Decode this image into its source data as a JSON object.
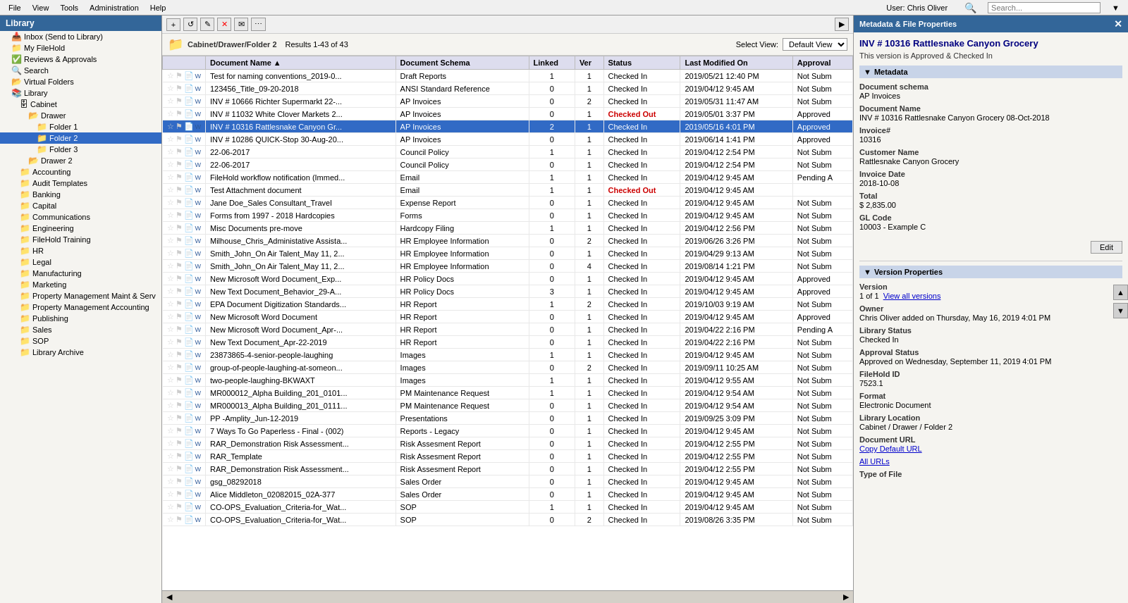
{
  "menubar": {
    "items": [
      "File",
      "View",
      "Tools",
      "Administration",
      "Help"
    ],
    "user": "User: Chris Oliver"
  },
  "sidebar": {
    "header": "Library",
    "items": [
      {
        "id": "inbox",
        "label": "Inbox (Send to Library)",
        "indent": 1,
        "icon": "📥"
      },
      {
        "id": "myfilehold",
        "label": "My FileHold",
        "indent": 1,
        "icon": "📁"
      },
      {
        "id": "reviews",
        "label": "Reviews & Approvals",
        "indent": 1,
        "icon": "✅"
      },
      {
        "id": "search",
        "label": "Search",
        "indent": 1,
        "icon": "🔍"
      },
      {
        "id": "virtualfolders",
        "label": "Virtual Folders",
        "indent": 1,
        "icon": "📂"
      },
      {
        "id": "library",
        "label": "Library",
        "indent": 1,
        "icon": "📚",
        "expanded": true
      },
      {
        "id": "cabinet",
        "label": "Cabinet",
        "indent": 2,
        "icon": "🗄",
        "expanded": true
      },
      {
        "id": "drawer",
        "label": "Drawer",
        "indent": 3,
        "icon": "📂",
        "expanded": true
      },
      {
        "id": "folder1",
        "label": "Folder 1",
        "indent": 4,
        "icon": "📁"
      },
      {
        "id": "folder2",
        "label": "Folder 2",
        "indent": 4,
        "icon": "📁",
        "selected": true
      },
      {
        "id": "folder3",
        "label": "Folder 3",
        "indent": 4,
        "icon": "📁"
      },
      {
        "id": "drawer2",
        "label": "Drawer 2",
        "indent": 3,
        "icon": "📂"
      },
      {
        "id": "accounting",
        "label": "Accounting",
        "indent": 2,
        "icon": "📁"
      },
      {
        "id": "audittemplates",
        "label": "Audit Templates",
        "indent": 2,
        "icon": "📁"
      },
      {
        "id": "banking",
        "label": "Banking",
        "indent": 2,
        "icon": "📁"
      },
      {
        "id": "capital",
        "label": "Capital",
        "indent": 2,
        "icon": "📁"
      },
      {
        "id": "communications",
        "label": "Communications",
        "indent": 2,
        "icon": "📁"
      },
      {
        "id": "engineering",
        "label": "Engineering",
        "indent": 2,
        "icon": "📁"
      },
      {
        "id": "fileholdtraining",
        "label": "FileHold Training",
        "indent": 2,
        "icon": "📁"
      },
      {
        "id": "hr",
        "label": "HR",
        "indent": 2,
        "icon": "📁"
      },
      {
        "id": "legal",
        "label": "Legal",
        "indent": 2,
        "icon": "📁"
      },
      {
        "id": "manufacturing",
        "label": "Manufacturing",
        "indent": 2,
        "icon": "📁"
      },
      {
        "id": "marketing",
        "label": "Marketing",
        "indent": 2,
        "icon": "📁"
      },
      {
        "id": "propmaint",
        "label": "Property Management  Maint & Serv",
        "indent": 2,
        "icon": "📁"
      },
      {
        "id": "propaccounting",
        "label": "Property Management Accounting",
        "indent": 2,
        "icon": "📁"
      },
      {
        "id": "publishing",
        "label": "Publishing",
        "indent": 2,
        "icon": "📁"
      },
      {
        "id": "sales",
        "label": "Sales",
        "indent": 2,
        "icon": "📁"
      },
      {
        "id": "sop",
        "label": "SOP",
        "indent": 2,
        "icon": "📁"
      },
      {
        "id": "libraryarchive",
        "label": "Library Archive",
        "indent": 2,
        "icon": "📁"
      }
    ]
  },
  "content": {
    "folder_path": "Cabinet/Drawer/Folder 2",
    "results_label": "Results 1-43 of 43",
    "view_label": "Select View:",
    "view_options": [
      "Default View"
    ],
    "view_selected": "Default View",
    "columns": [
      "Document Name",
      "Document Schema",
      "Linked",
      "Ver",
      "Status",
      "Last Modified On",
      "Approval"
    ],
    "rows": [
      {
        "name": "Test for naming conventions_2019-0...",
        "schema": "Draft Reports",
        "linked": "1",
        "ver": "1",
        "status": "Checked In",
        "modified": "2019/05/21 12:40 PM",
        "approval": "Not Subm"
      },
      {
        "name": "123456_Title_09-20-2018",
        "schema": "ANSI Standard Reference",
        "linked": "0",
        "ver": "1",
        "status": "Checked In",
        "modified": "2019/04/12 9:45 AM",
        "approval": "Not Subm"
      },
      {
        "name": "INV # 10666 Richter Supermarkt 22-...",
        "schema": "AP Invoices",
        "linked": "0",
        "ver": "2",
        "status": "Checked In",
        "modified": "2019/05/31 11:47 AM",
        "approval": "Not Subm"
      },
      {
        "name": "INV # 11032 White Clover Markets 2...",
        "schema": "AP Invoices",
        "linked": "0",
        "ver": "1",
        "status": "Checked Out",
        "modified": "2019/05/01 3:37 PM",
        "approval": "Approved",
        "checked_out": true
      },
      {
        "name": "INV # 10316 Rattlesnake Canyon Gr...",
        "schema": "AP Invoices",
        "linked": "2",
        "ver": "1",
        "status": "Checked In",
        "modified": "2019/05/16 4:01 PM",
        "approval": "Approved",
        "selected": true
      },
      {
        "name": "INV # 10286 QUICK-Stop 30-Aug-20...",
        "schema": "AP Invoices",
        "linked": "0",
        "ver": "1",
        "status": "Checked In",
        "modified": "2019/06/14 1:41 PM",
        "approval": "Approved"
      },
      {
        "name": "22-06-2017",
        "schema": "Council Policy",
        "linked": "1",
        "ver": "1",
        "status": "Checked In",
        "modified": "2019/04/12 2:54 PM",
        "approval": "Not Subm"
      },
      {
        "name": "22-06-2017",
        "schema": "Council Policy",
        "linked": "0",
        "ver": "1",
        "status": "Checked In",
        "modified": "2019/04/12 2:54 PM",
        "approval": "Not Subm"
      },
      {
        "name": "FileHold workflow notification (Immed...",
        "schema": "Email",
        "linked": "1",
        "ver": "1",
        "status": "Checked In",
        "modified": "2019/04/12 9:45 AM",
        "approval": "Pending A"
      },
      {
        "name": "Test Attachment document",
        "schema": "Email",
        "linked": "1",
        "ver": "1",
        "status": "Checked Out",
        "modified": "2019/04/12 9:45 AM",
        "approval": "",
        "checked_out": true
      },
      {
        "name": "Jane Doe_Sales Consultant_Travel",
        "schema": "Expense Report",
        "linked": "0",
        "ver": "1",
        "status": "Checked In",
        "modified": "2019/04/12 9:45 AM",
        "approval": "Not Subm"
      },
      {
        "name": "Forms from 1997 - 2018 Hardcopies",
        "schema": "Forms",
        "linked": "0",
        "ver": "1",
        "status": "Checked In",
        "modified": "2019/04/12 9:45 AM",
        "approval": "Not Subm"
      },
      {
        "name": "Misc Documents pre-move",
        "schema": "Hardcopy Filing",
        "linked": "1",
        "ver": "1",
        "status": "Checked In",
        "modified": "2019/04/12 2:56 PM",
        "approval": "Not Subm"
      },
      {
        "name": "Milhouse_Chris_Administative Assista...",
        "schema": "HR Employee Information",
        "linked": "0",
        "ver": "2",
        "status": "Checked In",
        "modified": "2019/06/26 3:26 PM",
        "approval": "Not Subm"
      },
      {
        "name": "Smith_John_On Air Talent_May 11, 2...",
        "schema": "HR Employee Information",
        "linked": "0",
        "ver": "1",
        "status": "Checked In",
        "modified": "2019/04/29 9:13 AM",
        "approval": "Not Subm"
      },
      {
        "name": "Smith_John_On Air Talent_May 11, 2...",
        "schema": "HR Employee Information",
        "linked": "0",
        "ver": "4",
        "status": "Checked In",
        "modified": "2019/08/14 1:21 PM",
        "approval": "Not Subm"
      },
      {
        "name": "New Microsoft Word Document_Exp...",
        "schema": "HR Policy Docs",
        "linked": "0",
        "ver": "1",
        "status": "Checked In",
        "modified": "2019/04/12 9:45 AM",
        "approval": "Approved"
      },
      {
        "name": "New Text Document_Behavior_29-A...",
        "schema": "HR Policy Docs",
        "linked": "3",
        "ver": "1",
        "status": "Checked In",
        "modified": "2019/04/12 9:45 AM",
        "approval": "Approved"
      },
      {
        "name": "EPA Document Digitization Standards...",
        "schema": "HR Report",
        "linked": "1",
        "ver": "2",
        "status": "Checked In",
        "modified": "2019/10/03 9:19 AM",
        "approval": "Not Subm"
      },
      {
        "name": "New Microsoft Word Document",
        "schema": "HR Report",
        "linked": "0",
        "ver": "1",
        "status": "Checked In",
        "modified": "2019/04/12 9:45 AM",
        "approval": "Approved"
      },
      {
        "name": "New Microsoft Word Document_Apr-...",
        "schema": "HR Report",
        "linked": "0",
        "ver": "1",
        "status": "Checked In",
        "modified": "2019/04/22 2:16 PM",
        "approval": "Pending A"
      },
      {
        "name": "New Text Document_Apr-22-2019",
        "schema": "HR Report",
        "linked": "0",
        "ver": "1",
        "status": "Checked In",
        "modified": "2019/04/22 2:16 PM",
        "approval": "Not Subm"
      },
      {
        "name": "23873865-4-senior-people-laughing",
        "schema": "Images",
        "linked": "1",
        "ver": "1",
        "status": "Checked In",
        "modified": "2019/04/12 9:45 AM",
        "approval": "Not Subm"
      },
      {
        "name": "group-of-people-laughing-at-someon...",
        "schema": "Images",
        "linked": "0",
        "ver": "2",
        "status": "Checked In",
        "modified": "2019/09/11 10:25 AM",
        "approval": "Not Subm"
      },
      {
        "name": "two-people-laughing-BKWAXT",
        "schema": "Images",
        "linked": "1",
        "ver": "1",
        "status": "Checked In",
        "modified": "2019/04/12 9:55 AM",
        "approval": "Not Subm"
      },
      {
        "name": "MR000012_Alpha Building_201_0101...",
        "schema": "PM Maintenance Request",
        "linked": "1",
        "ver": "1",
        "status": "Checked In",
        "modified": "2019/04/12 9:54 AM",
        "approval": "Not Subm"
      },
      {
        "name": "MR000013_Alpha Building_201_0111...",
        "schema": "PM Maintenance Request",
        "linked": "0",
        "ver": "1",
        "status": "Checked In",
        "modified": "2019/04/12 9:54 AM",
        "approval": "Not Subm"
      },
      {
        "name": "PP -Amplity_Jun-12-2019",
        "schema": "Presentations",
        "linked": "0",
        "ver": "1",
        "status": "Checked In",
        "modified": "2019/09/25 3:09 PM",
        "approval": "Not Subm"
      },
      {
        "name": "7 Ways To Go Paperless - Final - (002)",
        "schema": "Reports - Legacy",
        "linked": "0",
        "ver": "1",
        "status": "Checked In",
        "modified": "2019/04/12 9:45 AM",
        "approval": "Not Subm"
      },
      {
        "name": "RAR_Demonstration Risk Assessment...",
        "schema": "Risk Assesment Report",
        "linked": "0",
        "ver": "1",
        "status": "Checked In",
        "modified": "2019/04/12 2:55 PM",
        "approval": "Not Subm"
      },
      {
        "name": "RAR_Template",
        "schema": "Risk Assesment Report",
        "linked": "0",
        "ver": "1",
        "status": "Checked In",
        "modified": "2019/04/12 2:55 PM",
        "approval": "Not Subm"
      },
      {
        "name": "RAR_Demonstration Risk Assessment...",
        "schema": "Risk Assesment Report",
        "linked": "0",
        "ver": "1",
        "status": "Checked In",
        "modified": "2019/04/12 2:55 PM",
        "approval": "Not Subm"
      },
      {
        "name": "gsg_08292018",
        "schema": "Sales Order",
        "linked": "0",
        "ver": "1",
        "status": "Checked In",
        "modified": "2019/04/12 9:45 AM",
        "approval": "Not Subm"
      },
      {
        "name": "Alice Middleton_02082015_02A-377",
        "schema": "Sales Order",
        "linked": "0",
        "ver": "1",
        "status": "Checked In",
        "modified": "2019/04/12 9:45 AM",
        "approval": "Not Subm"
      },
      {
        "name": "CO-OPS_Evaluation_Criteria-for_Wat...",
        "schema": "SOP",
        "linked": "1",
        "ver": "1",
        "status": "Checked In",
        "modified": "2019/04/12 9:45 AM",
        "approval": "Not Subm"
      },
      {
        "name": "CO-OPS_Evaluation_Criteria-for_Wat...",
        "schema": "SOP",
        "linked": "0",
        "ver": "2",
        "status": "Checked In",
        "modified": "2019/08/26 3:35 PM",
        "approval": "Not Subm"
      }
    ]
  },
  "right_panel": {
    "header": "Metadata & File Properties",
    "title": "INV # 10316 Rattlesnake Canyon Grocery",
    "subtitle": "This version is Approved & Checked In",
    "metadata_section": "Metadata",
    "version_section": "Version Properties",
    "fields": {
      "document_schema_label": "Document schema",
      "document_schema_value": "AP Invoices",
      "document_name_label": "Document Name",
      "document_name_value": "INV # 10316 Rattlesnake Canyon Grocery 08-Oct-2018",
      "invoice_label": "Invoice#",
      "invoice_value": "10316",
      "customer_name_label": "Customer Name",
      "customer_name_value": "Rattlesnake Canyon Grocery",
      "invoice_date_label": "Invoice Date",
      "invoice_date_value": "2018-10-08",
      "total_label": "Total",
      "total_value": "$ 2,835.00",
      "gl_code_label": "GL Code",
      "gl_code_value": "10003 - Example C",
      "edit_btn": "Edit"
    },
    "version_fields": {
      "version_label": "Version",
      "version_value": "1 of 1",
      "view_all_label": "View all versions",
      "owner_label": "Owner",
      "owner_value": "Chris Oliver added on Thursday, May 16, 2019 4:01 PM",
      "library_status_label": "Library Status",
      "library_status_value": "Checked In",
      "approval_status_label": "Approval Status",
      "approval_status_value": "Approved on Wednesday, September 11, 2019 4:01 PM",
      "filehold_id_label": "FileHold ID",
      "filehold_id_value": "7523.1",
      "format_label": "Format",
      "format_value": "Electronic Document",
      "library_location_label": "Library Location",
      "library_location_value": "Cabinet / Drawer / Folder 2",
      "document_url_label": "Document URL",
      "copy_default_url_label": "Copy Default URL",
      "all_urls_label": "All URLs",
      "type_of_file_label": "Type of File"
    }
  }
}
